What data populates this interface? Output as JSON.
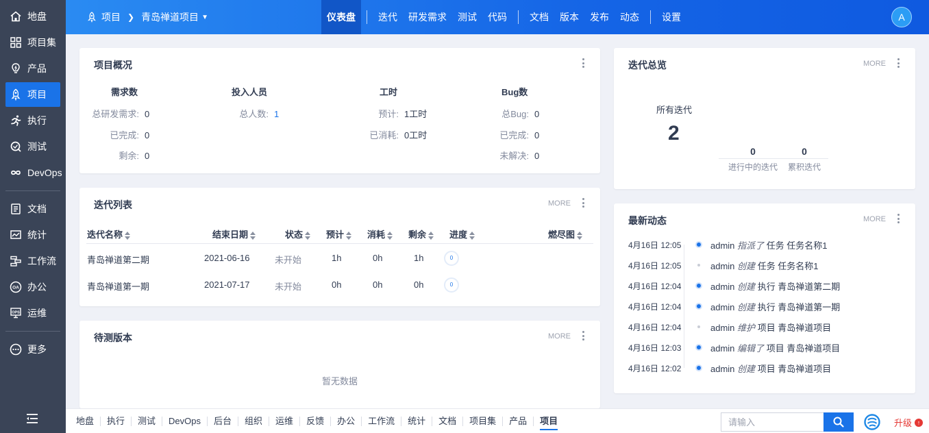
{
  "sidebar": {
    "items": [
      {
        "label": "地盘",
        "icon": "home-icon"
      },
      {
        "label": "项目集",
        "icon": "grid-icon"
      },
      {
        "label": "产品",
        "icon": "bulb-icon"
      },
      {
        "label": "项目",
        "icon": "rocket-icon",
        "active": true
      },
      {
        "label": "执行",
        "icon": "run-icon"
      },
      {
        "label": "测试",
        "icon": "test-icon"
      },
      {
        "label": "DevOps",
        "icon": "infinity-icon"
      }
    ],
    "items2": [
      {
        "label": "文档",
        "icon": "doc-icon"
      },
      {
        "label": "统计",
        "icon": "chart-icon"
      },
      {
        "label": "工作流",
        "icon": "workflow-icon"
      },
      {
        "label": "办公",
        "icon": "oa-icon"
      },
      {
        "label": "运维",
        "icon": "ops-icon"
      }
    ],
    "more": "更多"
  },
  "header": {
    "breadcrumb_root": "项目",
    "breadcrumb_current": "青岛禅道项目",
    "nav_group1": [
      "仪表盘"
    ],
    "nav_group2": [
      "迭代",
      "研发需求",
      "测试",
      "代码"
    ],
    "nav_group3": [
      "文档",
      "版本",
      "发布",
      "动态"
    ],
    "nav_group4": [
      "设置"
    ],
    "avatar": "A"
  },
  "overview": {
    "title": "项目概况",
    "stories": {
      "head": "需求数",
      "total_label": "总研发需求:",
      "total": "0",
      "done_label": "已完成:",
      "done": "0",
      "left_label": "剩余:",
      "left": "0"
    },
    "members": {
      "head": "投入人员",
      "total_label": "总人数:",
      "total": "1"
    },
    "hours": {
      "head": "工时",
      "estimate_label": "预计:",
      "estimate": "1工时",
      "consumed_label": "已消耗:",
      "consumed": "0工时"
    },
    "bugs": {
      "head": "Bug数",
      "total_label": "总Bug:",
      "total": "0",
      "done_label": "已完成:",
      "done": "0",
      "open_label": "未解决:",
      "open": "0"
    }
  },
  "iteration_list": {
    "title": "迭代列表",
    "more": "MORE",
    "columns": [
      "迭代名称",
      "结束日期",
      "状态",
      "预计",
      "消耗",
      "剩余",
      "进度",
      "燃尽图"
    ],
    "rows": [
      {
        "name": "青岛禅道第二期",
        "end": "2021-06-16",
        "status": "未开始",
        "estimate": "1h",
        "consumed": "0h",
        "left": "1h",
        "progress": "0"
      },
      {
        "name": "青岛禅道第一期",
        "end": "2021-07-17",
        "status": "未开始",
        "estimate": "0h",
        "consumed": "0h",
        "left": "0h",
        "progress": "0"
      }
    ]
  },
  "builds": {
    "title": "待测版本",
    "more": "MORE",
    "empty": "暂无数据"
  },
  "iteration_overview": {
    "title": "迭代总览",
    "more": "MORE",
    "all_label": "所有迭代",
    "all_value": "2",
    "doing_value": "0",
    "doing_label": "进行中的迭代",
    "total_value": "0",
    "total_label": "累积迭代"
  },
  "activity": {
    "title": "最新动态",
    "more": "MORE",
    "items": [
      {
        "time": "4月16日 12:05",
        "actor": "admin",
        "action": "指派了",
        "rest": "任务 任务名称1",
        "dot": "blue"
      },
      {
        "time": "4月16日 12:05",
        "actor": "admin",
        "action": "创建",
        "rest": "任务 任务名称1",
        "dot": "grey"
      },
      {
        "time": "4月16日 12:04",
        "actor": "admin",
        "action": "创建",
        "rest": "执行 青岛禅道第二期",
        "dot": "blue"
      },
      {
        "time": "4月16日 12:04",
        "actor": "admin",
        "action": "创建",
        "rest": "执行 青岛禅道第一期",
        "dot": "blue"
      },
      {
        "time": "4月16日 12:04",
        "actor": "admin",
        "action": "维护",
        "rest": "项目 青岛禅道项目",
        "dot": "grey"
      },
      {
        "time": "4月16日 12:03",
        "actor": "admin",
        "action": "编辑了",
        "rest": "项目 青岛禅道项目",
        "dot": "blue"
      },
      {
        "time": "4月16日 12:02",
        "actor": "admin",
        "action": "创建",
        "rest": "项目 青岛禅道项目",
        "dot": "blue"
      }
    ]
  },
  "bottombar": {
    "items": [
      "地盘",
      "执行",
      "测试",
      "DevOps",
      "后台",
      "组织",
      "运维",
      "反馈",
      "办公",
      "工作流",
      "统计",
      "文档",
      "项目集",
      "产品",
      "项目"
    ],
    "active_index": 14,
    "search_placeholder": "请输入",
    "upgrade": "升级"
  }
}
